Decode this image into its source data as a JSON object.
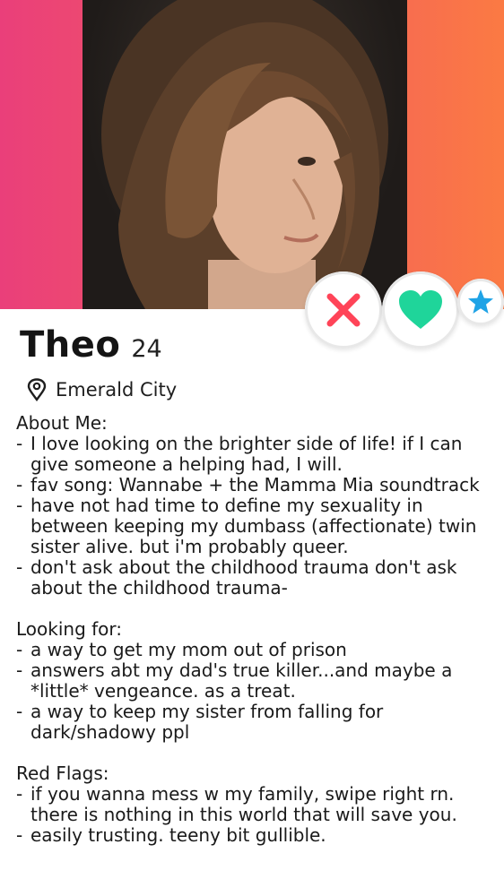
{
  "profile": {
    "name": "Theo",
    "age": "24",
    "location": "Emerald City",
    "photo_description": "portrait photo"
  },
  "actions": {
    "nope_icon": "close-icon",
    "like_icon": "heart-icon",
    "super_like_icon": "star-icon",
    "nope_color": "#ff4458",
    "like_color": "#1fd59a",
    "super_like_color": "#1fa3e6"
  },
  "bio": {
    "about_heading": "About Me:",
    "about_items": [
      "I love looking on the brighter side of life! if I can give someone a helping had, I will.",
      "fav song: Wannabe + the Mamma Mia soundtrack",
      "have not had time to define my sexuality in between keeping my dumbass (affectionate) twin sister alive. but i'm probably queer.",
      "don't ask about the childhood trauma don't ask about the childhood trauma-"
    ],
    "looking_heading": "Looking for:",
    "looking_items": [
      "a way to get my mom out of prison",
      "answers abt my dad's true killer...and maybe a *little* vengeance. as a treat.",
      "a way to keep my sister from falling for dark/shadowy ppl"
    ],
    "flags_heading": "Red Flags:",
    "flags_items": [
      "if you wanna mess w my family, swipe right rn. there is nothing in this world that will save you.",
      "easily trusting. teeny bit gullible."
    ]
  },
  "theme": {
    "gradient_left": "#ea3f7a",
    "gradient_right": "#fb7a43"
  }
}
